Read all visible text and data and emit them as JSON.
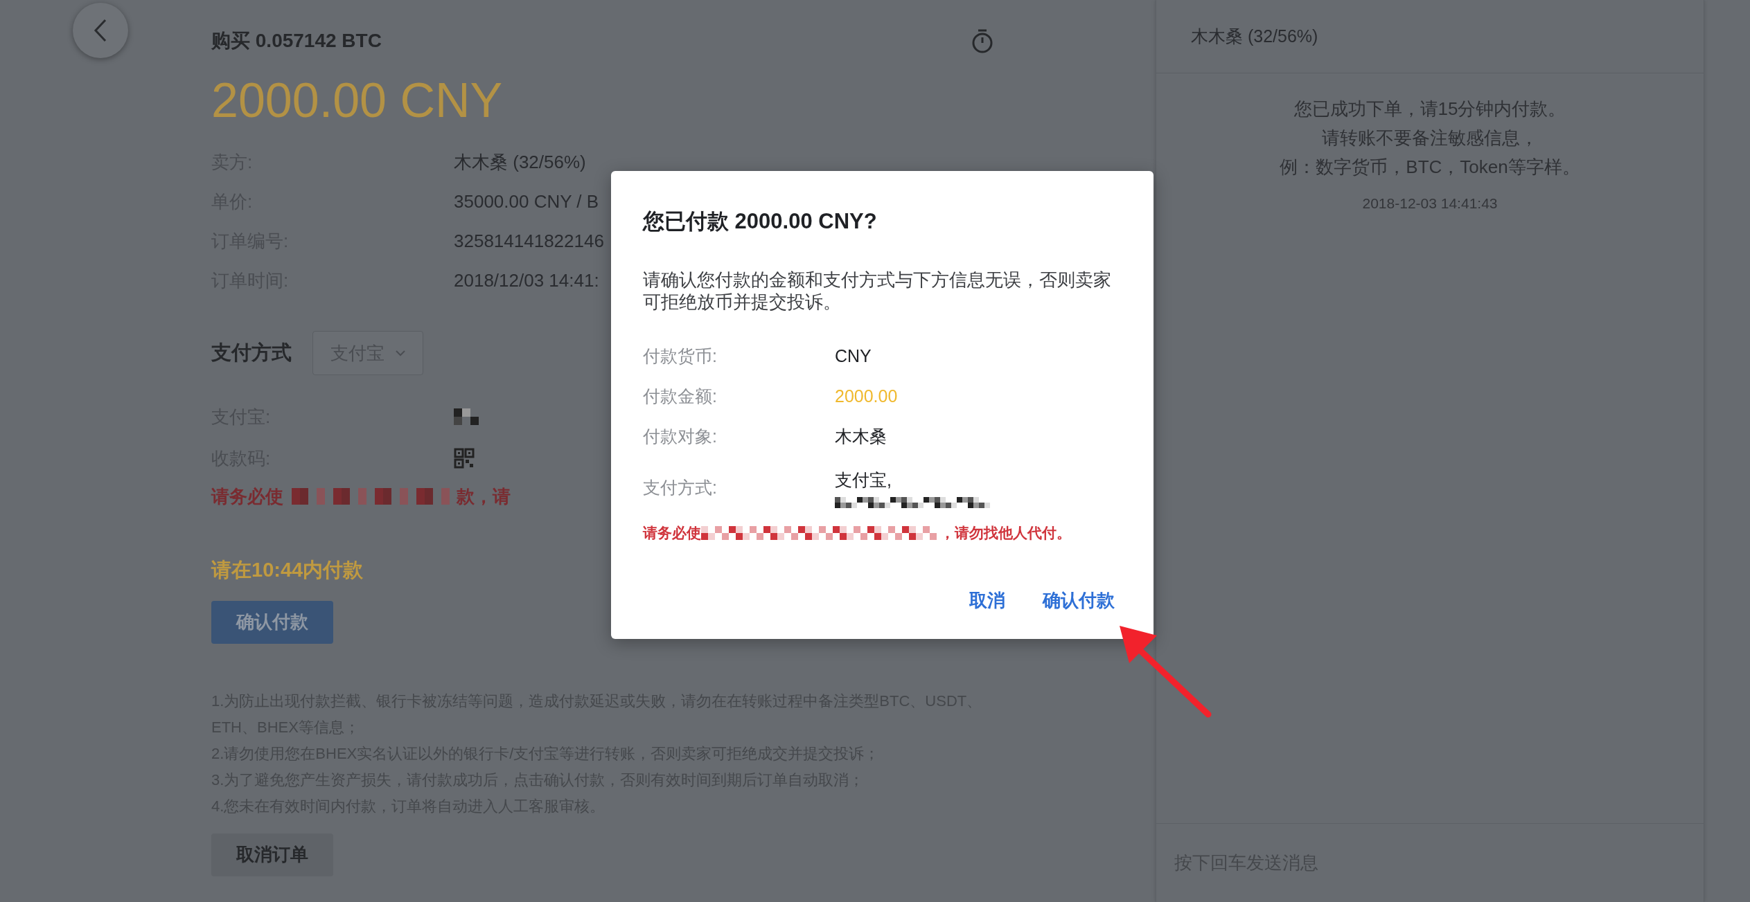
{
  "order": {
    "title": "购买 0.057142 BTC",
    "amount": "2000.00 CNY",
    "details": [
      {
        "label": "卖方:",
        "value": "木木桑 (32/56%)"
      },
      {
        "label": "单价:",
        "value": "35000.00 CNY / B"
      },
      {
        "label": "订单编号:",
        "value": "325814141822146"
      },
      {
        "label": "订单时间:",
        "value": "2018/12/03 14:41:"
      }
    ]
  },
  "payment": {
    "heading": "支付方式",
    "method_select": "支付宝",
    "rows": [
      {
        "label": "支付宝:",
        "kind": "redacted"
      },
      {
        "label": "收款码:",
        "kind": "qr"
      }
    ],
    "warning": {
      "before": "请务必使",
      "after": "款，请"
    }
  },
  "countdown": "请在10:44内付款",
  "confirm_button": "确认付款",
  "notes": [
    "1.为防止出现付款拦截、银行卡被冻结等问题，造成付款延迟或失败，请勿在在转账过程中备注类型BTC、USDT、ETH、BHEX等信息；",
    "2.请勿使用您在BHEX实名认证以外的银行卡/支付宝等进行转账，否则卖家可拒绝成交并提交投诉；",
    "3.为了避免您产生资产损失，请付款成功后，点击确认付款，否则有效时间到期后订单自动取消；",
    "4.您未在有效时间内付款，订单将自动进入人工客服审核。"
  ],
  "cancel_button": "取消订单",
  "chat": {
    "header": "木木桑 (32/56%)",
    "messages": [
      {
        "lines": [
          "您已成功下单，请15分钟内付款。",
          "请转账不要备注敏感信息，",
          "例：数字货币，BTC，Token等字样。"
        ],
        "time": "2018-12-03 14:41:43"
      }
    ],
    "input": {
      "placeholder": "按下回车发送消息"
    }
  },
  "dialog": {
    "title": "您已付款 2000.00 CNY?",
    "message": "请确认您付款的金额和支付方式与下方信息无误，否则卖家可拒绝放币并提交投诉。",
    "rows": [
      {
        "label": "付款货币:",
        "kind": "text",
        "value": "CNY"
      },
      {
        "label": "付款金额:",
        "kind": "highlight",
        "value": "2000.00"
      },
      {
        "label": "付款对象:",
        "kind": "text",
        "value": "木木桑"
      },
      {
        "label": "支付方式:",
        "kind": "account",
        "value": "支付宝,"
      }
    ],
    "warning": {
      "before": "请务必使",
      "after": "，请勿找他人代付。"
    },
    "buttons": [
      "取消",
      "确认付款"
    ]
  }
}
